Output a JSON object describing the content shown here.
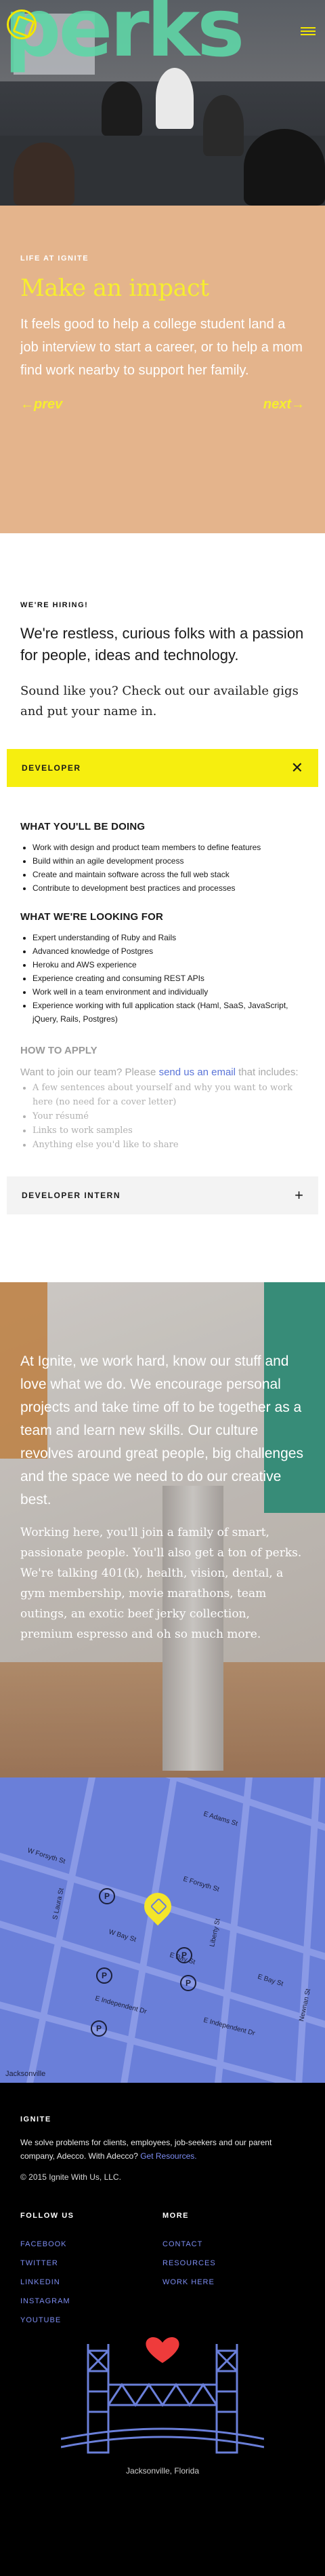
{
  "hero": {
    "brand_word": "perks"
  },
  "impact": {
    "eyebrow": "LIFE AT IGNITE",
    "heading": "Make an impact",
    "body": "It feels good to help a college student land a job interview to start a career, or to help a mom find work nearby to support her family.",
    "prev_label": "←prev",
    "next_label": "next→"
  },
  "hiring": {
    "eyebrow": "WE'RE HIRING!",
    "lead": "We're restless, curious folks with a passion for people, ideas and technology.",
    "sub": "Sound like you? Check out our available gigs and put your name in.",
    "jobs": [
      {
        "title": "DEVELOPER",
        "toggle": "✕"
      },
      {
        "title": "DEVELOPER INTERN",
        "toggle": "+"
      }
    ]
  },
  "details": {
    "todo_heading": "WHAT YOU'LL BE DOING",
    "todo": [
      "Work with design and product team members to define features",
      "Build within an agile development process",
      "Create and maintain software across the full web stack",
      "Contribute to development best practices and processes"
    ],
    "looking_heading": "WHAT WE'RE LOOKING FOR",
    "looking": [
      "Expert understanding of Ruby and Rails",
      "Advanced knowledge of Postgres",
      "Heroku and AWS experience",
      "Experience creating and consuming REST APIs",
      "Work well in a team environment and individually",
      "Experience working with full application stack (Haml, SaaS, JavaScript, jQuery, Rails, Postgres)"
    ],
    "apply_heading": "HOW TO APPLY",
    "apply_pre": "Want to join our team? Please ",
    "apply_link": "send us an email",
    "apply_post": " that includes:",
    "apply_items": [
      "A few sentences about yourself and why you want to work here (no need for a cover letter)",
      "Your résumé",
      "Links to work samples",
      "Anything else you'd like to share"
    ]
  },
  "culture": {
    "para1": "At Ignite, we work hard, know our stuff and love what we do. We encourage personal projects and take time off to be together as a team and learn new skills. Our culture revolves around great people, big challenges and the space we need to do our creative best.",
    "para2": "Working here, you'll join a family of smart, passionate people. You'll also get a ton of perks. We're talking 401(k), health, vision, dental, a gym membership, movie marathons, team outings, an exotic beef jerky collection, premium espresso and oh so much more."
  },
  "map": {
    "streets": [
      "E Adams St",
      "W Forsyth St",
      "E Forsyth St",
      "W Bay St",
      "E Bay St",
      "E Bay St",
      "E Independent Dr",
      "E Independent Dr",
      "S Laura St",
      "Liberty St",
      "Newnan St",
      "Jacksonville"
    ],
    "parking_label": "P"
  },
  "footer": {
    "eyebrow": "IGNITE",
    "about_pre": "We solve problems for clients, employees, job-seekers and our parent company, Adecco. With Adecco? ",
    "about_link": "Get Resources.",
    "copyright": "© 2015 Ignite With Us, LLC.",
    "follow_heading": "FOLLOW US",
    "follow": [
      "FACEBOOK",
      "TWITTER",
      "LINKEDIN",
      "INSTAGRAM",
      "YOUTUBE"
    ],
    "more_heading": "MORE",
    "more": [
      "CONTACT",
      "RESOURCES",
      "WORK HERE"
    ],
    "city": "Jacksonville, Florida"
  },
  "colors": {
    "accent_yellow": "#f6ee2e",
    "accent_green": "#5fd6a7",
    "link_blue": "#7c8cf0",
    "impact_bg": "#e4b48c",
    "map_bg": "#6a7fd9"
  }
}
